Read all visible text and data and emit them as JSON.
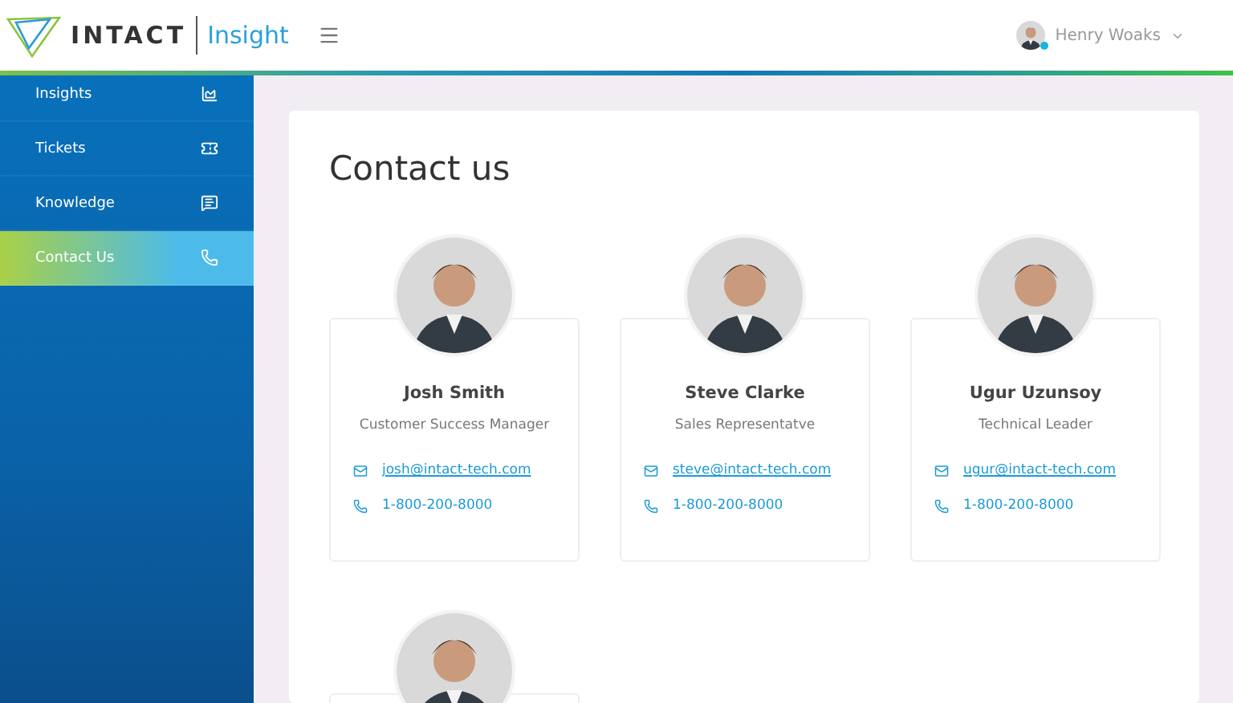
{
  "header": {
    "brand": "INTACT",
    "product": "Insight",
    "user": {
      "name": "Henry Woaks",
      "online": true
    }
  },
  "sidebar": {
    "items": [
      {
        "label": "Insights",
        "selected": false
      },
      {
        "label": "Tickets",
        "selected": false
      },
      {
        "label": "Knowledge",
        "selected": false
      },
      {
        "label": "Contact Us",
        "selected": true
      }
    ]
  },
  "page": {
    "title": "Contact us"
  },
  "contacts": [
    {
      "kind": "full",
      "name": "Josh Smith",
      "role": "Customer Success Manager",
      "email": "josh@intact-tech.com",
      "phone": "1-800-200-8000"
    },
    {
      "kind": "full",
      "name": "Steve Clarke",
      "role": "Sales Representatve",
      "email": "steve@intact-tech.com",
      "phone": "1-800-200-8000"
    },
    {
      "kind": "full",
      "name": "Ugur Uzunsoy",
      "role": "Technical Leader",
      "email": "ugur@intact-tech.com",
      "phone": "1-800-200-8000"
    },
    {
      "kind": "cut"
    }
  ]
}
